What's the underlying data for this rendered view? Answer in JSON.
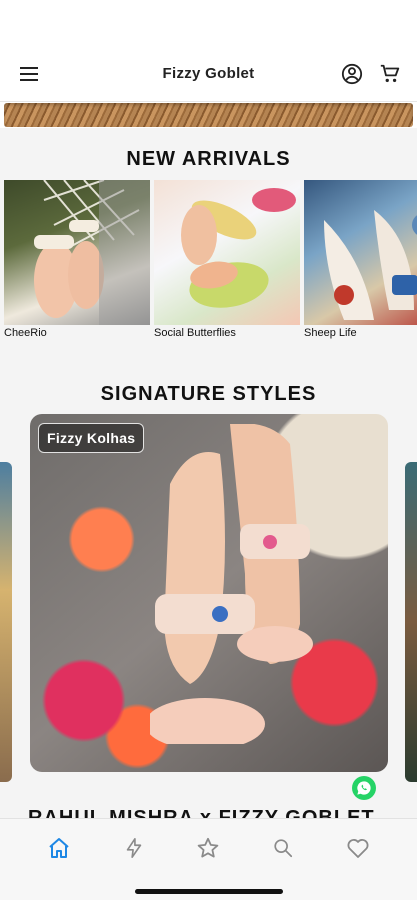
{
  "header": {
    "title": "Fizzy Goblet",
    "icons": [
      "menu-icon",
      "account-icon",
      "cart-icon"
    ]
  },
  "sections": {
    "new_arrivals": {
      "title": "NEW ARRIVALS",
      "items": [
        {
          "label": "CheeRio"
        },
        {
          "label": "Social Butterflies"
        },
        {
          "label": "Sheep Life"
        }
      ]
    },
    "signature_styles": {
      "title": "SIGNATURE STYLES",
      "card_label": "Fizzy Kolhas"
    },
    "next_section_partial": "RAHUL MISHRA x FIZZY GOBLET"
  },
  "tab_bar": {
    "tabs": [
      "home-icon",
      "lightning-icon",
      "star-icon",
      "search-icon",
      "heart-icon"
    ],
    "active_tab": "home-icon"
  },
  "colors": {
    "active_tab": "#1e88e5",
    "inactive_tab": "#8a8a8a",
    "whatsapp": "#25d366"
  }
}
